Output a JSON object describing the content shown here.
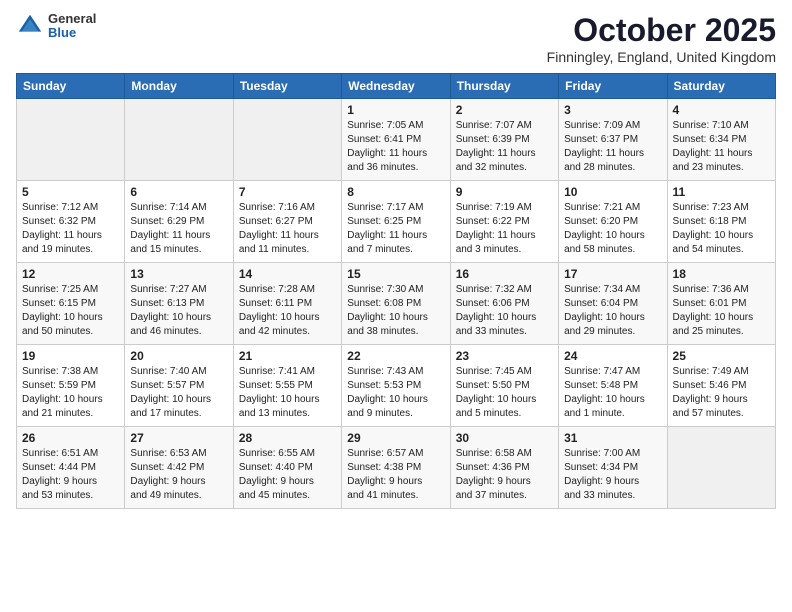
{
  "header": {
    "logo": {
      "general": "General",
      "blue": "Blue"
    },
    "title": "October 2025",
    "location": "Finningley, England, United Kingdom"
  },
  "calendar": {
    "days_of_week": [
      "Sunday",
      "Monday",
      "Tuesday",
      "Wednesday",
      "Thursday",
      "Friday",
      "Saturday"
    ],
    "weeks": [
      [
        {
          "day": "",
          "info": ""
        },
        {
          "day": "",
          "info": ""
        },
        {
          "day": "",
          "info": ""
        },
        {
          "day": "1",
          "info": "Sunrise: 7:05 AM\nSunset: 6:41 PM\nDaylight: 11 hours\nand 36 minutes."
        },
        {
          "day": "2",
          "info": "Sunrise: 7:07 AM\nSunset: 6:39 PM\nDaylight: 11 hours\nand 32 minutes."
        },
        {
          "day": "3",
          "info": "Sunrise: 7:09 AM\nSunset: 6:37 PM\nDaylight: 11 hours\nand 28 minutes."
        },
        {
          "day": "4",
          "info": "Sunrise: 7:10 AM\nSunset: 6:34 PM\nDaylight: 11 hours\nand 23 minutes."
        }
      ],
      [
        {
          "day": "5",
          "info": "Sunrise: 7:12 AM\nSunset: 6:32 PM\nDaylight: 11 hours\nand 19 minutes."
        },
        {
          "day": "6",
          "info": "Sunrise: 7:14 AM\nSunset: 6:29 PM\nDaylight: 11 hours\nand 15 minutes."
        },
        {
          "day": "7",
          "info": "Sunrise: 7:16 AM\nSunset: 6:27 PM\nDaylight: 11 hours\nand 11 minutes."
        },
        {
          "day": "8",
          "info": "Sunrise: 7:17 AM\nSunset: 6:25 PM\nDaylight: 11 hours\nand 7 minutes."
        },
        {
          "day": "9",
          "info": "Sunrise: 7:19 AM\nSunset: 6:22 PM\nDaylight: 11 hours\nand 3 minutes."
        },
        {
          "day": "10",
          "info": "Sunrise: 7:21 AM\nSunset: 6:20 PM\nDaylight: 10 hours\nand 58 minutes."
        },
        {
          "day": "11",
          "info": "Sunrise: 7:23 AM\nSunset: 6:18 PM\nDaylight: 10 hours\nand 54 minutes."
        }
      ],
      [
        {
          "day": "12",
          "info": "Sunrise: 7:25 AM\nSunset: 6:15 PM\nDaylight: 10 hours\nand 50 minutes."
        },
        {
          "day": "13",
          "info": "Sunrise: 7:27 AM\nSunset: 6:13 PM\nDaylight: 10 hours\nand 46 minutes."
        },
        {
          "day": "14",
          "info": "Sunrise: 7:28 AM\nSunset: 6:11 PM\nDaylight: 10 hours\nand 42 minutes."
        },
        {
          "day": "15",
          "info": "Sunrise: 7:30 AM\nSunset: 6:08 PM\nDaylight: 10 hours\nand 38 minutes."
        },
        {
          "day": "16",
          "info": "Sunrise: 7:32 AM\nSunset: 6:06 PM\nDaylight: 10 hours\nand 33 minutes."
        },
        {
          "day": "17",
          "info": "Sunrise: 7:34 AM\nSunset: 6:04 PM\nDaylight: 10 hours\nand 29 minutes."
        },
        {
          "day": "18",
          "info": "Sunrise: 7:36 AM\nSunset: 6:01 PM\nDaylight: 10 hours\nand 25 minutes."
        }
      ],
      [
        {
          "day": "19",
          "info": "Sunrise: 7:38 AM\nSunset: 5:59 PM\nDaylight: 10 hours\nand 21 minutes."
        },
        {
          "day": "20",
          "info": "Sunrise: 7:40 AM\nSunset: 5:57 PM\nDaylight: 10 hours\nand 17 minutes."
        },
        {
          "day": "21",
          "info": "Sunrise: 7:41 AM\nSunset: 5:55 PM\nDaylight: 10 hours\nand 13 minutes."
        },
        {
          "day": "22",
          "info": "Sunrise: 7:43 AM\nSunset: 5:53 PM\nDaylight: 10 hours\nand 9 minutes."
        },
        {
          "day": "23",
          "info": "Sunrise: 7:45 AM\nSunset: 5:50 PM\nDaylight: 10 hours\nand 5 minutes."
        },
        {
          "day": "24",
          "info": "Sunrise: 7:47 AM\nSunset: 5:48 PM\nDaylight: 10 hours\nand 1 minute."
        },
        {
          "day": "25",
          "info": "Sunrise: 7:49 AM\nSunset: 5:46 PM\nDaylight: 9 hours\nand 57 minutes."
        }
      ],
      [
        {
          "day": "26",
          "info": "Sunrise: 6:51 AM\nSunset: 4:44 PM\nDaylight: 9 hours\nand 53 minutes."
        },
        {
          "day": "27",
          "info": "Sunrise: 6:53 AM\nSunset: 4:42 PM\nDaylight: 9 hours\nand 49 minutes."
        },
        {
          "day": "28",
          "info": "Sunrise: 6:55 AM\nSunset: 4:40 PM\nDaylight: 9 hours\nand 45 minutes."
        },
        {
          "day": "29",
          "info": "Sunrise: 6:57 AM\nSunset: 4:38 PM\nDaylight: 9 hours\nand 41 minutes."
        },
        {
          "day": "30",
          "info": "Sunrise: 6:58 AM\nSunset: 4:36 PM\nDaylight: 9 hours\nand 37 minutes."
        },
        {
          "day": "31",
          "info": "Sunrise: 7:00 AM\nSunset: 4:34 PM\nDaylight: 9 hours\nand 33 minutes."
        },
        {
          "day": "",
          "info": ""
        }
      ]
    ]
  }
}
